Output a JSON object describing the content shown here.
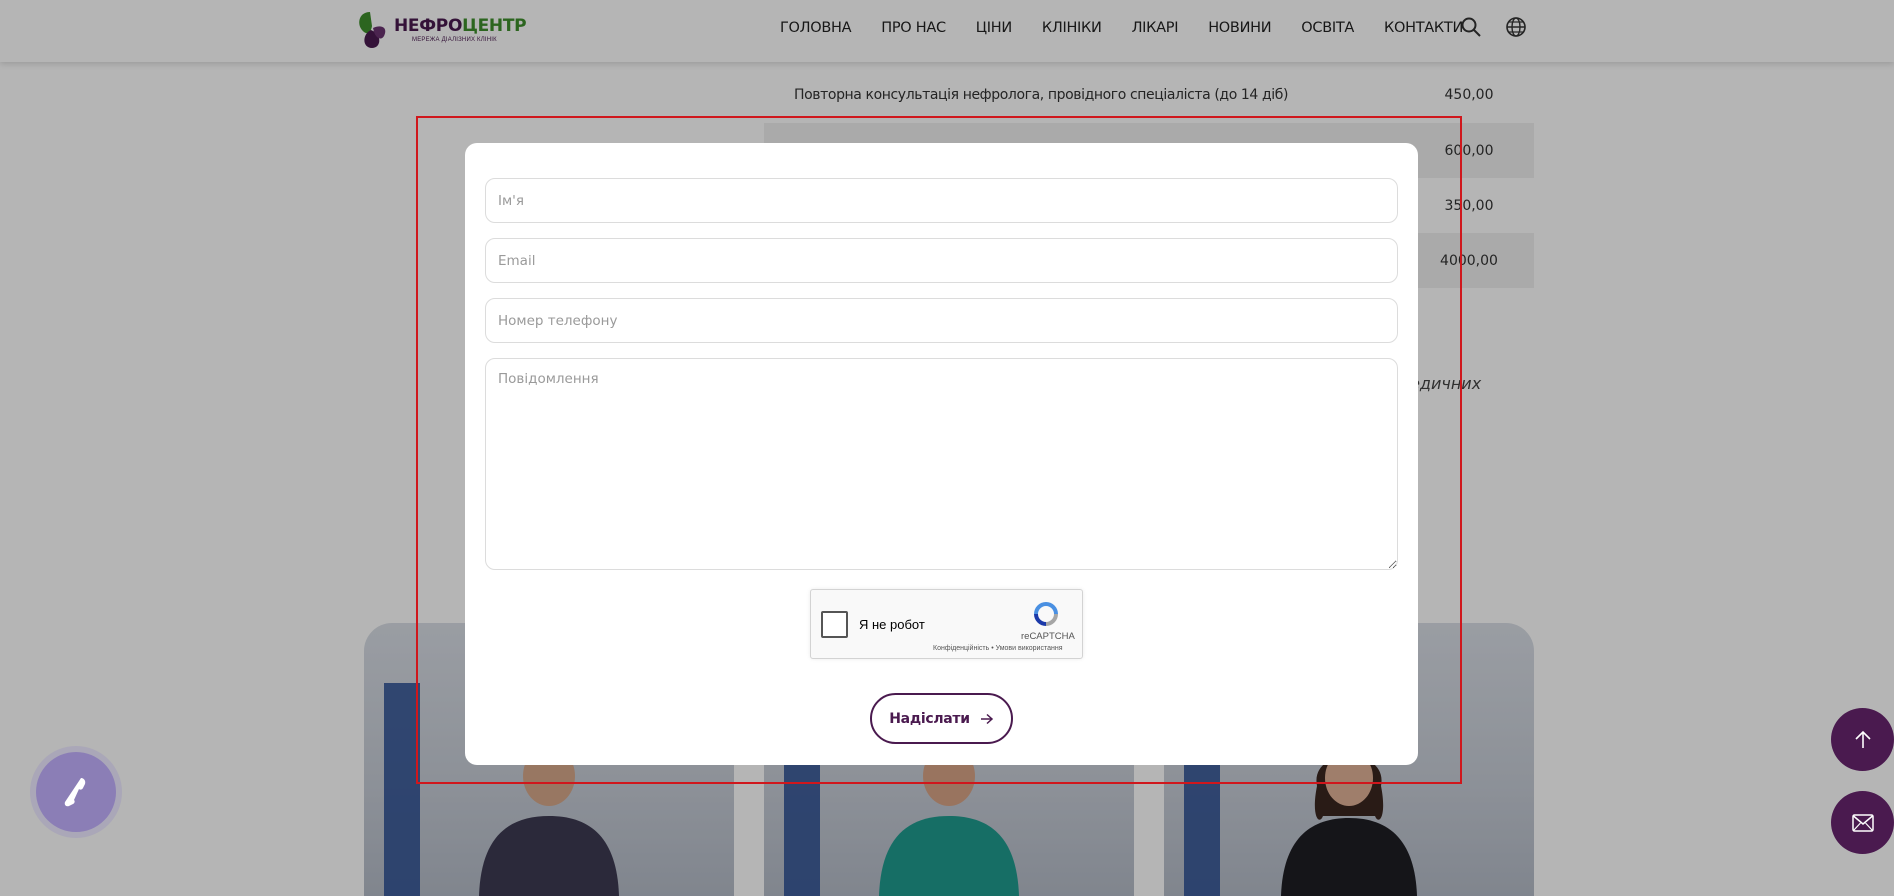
{
  "header": {
    "logo": {
      "part1": "НЕФРО",
      "part2": "ЦЕНТР",
      "subtitle": "МЕРЕЖА ДІАЛІЗНИХ КЛІНІК"
    },
    "nav": [
      "ГОЛОВНА",
      "ПРО НАС",
      "ЦІНИ",
      "КЛІНІКИ",
      "ЛІКАРІ",
      "НОВИНИ",
      "ОСВІТА",
      "КОНТАКТИ"
    ],
    "icons": [
      "search-icon",
      "globe-icon"
    ]
  },
  "prices": {
    "rows": [
      {
        "name": "Повторна консультація нефролога, провідного спеціаліста (до 14 діб)",
        "value": "450,00"
      },
      {
        "name": "",
        "value": "600,00"
      },
      {
        "name": "",
        "value": "350,00"
      },
      {
        "name": "",
        "value": "4000,00"
      }
    ],
    "note_fragment": "медичних"
  },
  "form": {
    "name_placeholder": "Ім'я",
    "email_placeholder": "Email",
    "phone_placeholder": "Номер телефону",
    "message_placeholder": "Повідомлення",
    "captcha": {
      "label": "Я не робот",
      "brand": "reCAPTCHA",
      "links": "Конфіденційність • Умови використання"
    },
    "submit_label": "Надіслати"
  },
  "colors": {
    "brand_purple": "#4a1a4f",
    "brand_green": "#3e8f2c",
    "phone_button": "#8b7eb6",
    "highlight": "#d0171c"
  },
  "floating": {
    "phone_icon": "phone-icon",
    "up_icon": "arrow-up-icon",
    "mail_icon": "mail-icon"
  }
}
